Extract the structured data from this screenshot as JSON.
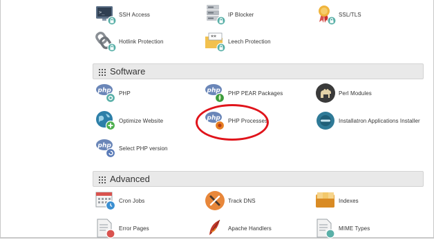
{
  "top_items": [
    {
      "label": "SSH Access",
      "icon": "terminal-lock-icon"
    },
    {
      "label": "IP Blocker",
      "icon": "server-lock-icon"
    },
    {
      "label": "SSL/TLS",
      "icon": "certificate-lock-icon"
    },
    {
      "label": "Hotlink Protection",
      "icon": "chain-link-lock-icon"
    },
    {
      "label": "Leech Protection",
      "icon": "folder-password-lock-icon"
    }
  ],
  "software": {
    "title": "Software",
    "items": [
      {
        "label": "PHP",
        "icon": "php-gear-icon"
      },
      {
        "label": "PHP PEAR Packages",
        "icon": "php-pear-icon"
      },
      {
        "label": "Perl Modules",
        "icon": "camel-icon"
      },
      {
        "label": "Optimize Website",
        "icon": "globe-plus-icon"
      },
      {
        "label": "PHP Processes",
        "icon": "php-process-icon"
      },
      {
        "label": "Installatron Applications Installer",
        "icon": "installatron-icon"
      },
      {
        "label": "Select PHP version",
        "icon": "php-select-icon"
      }
    ]
  },
  "advanced": {
    "title": "Advanced",
    "items": [
      {
        "label": "Cron Jobs",
        "icon": "calendar-clock-icon"
      },
      {
        "label": "Track DNS",
        "icon": "tools-icon"
      },
      {
        "label": "Indexes",
        "icon": "index-cards-icon"
      },
      {
        "label": "Error Pages",
        "icon": "error-page-icon"
      },
      {
        "label": "Apache Handlers",
        "icon": "feather-icon"
      },
      {
        "label": "MIME Types",
        "icon": "mime-file-icon"
      }
    ]
  },
  "colors": {
    "highlight_ring": "#e0141b",
    "section_bg": "#e9e9e9",
    "lock_badge": "#5ab0a8",
    "php_blue": "#6a86b8"
  }
}
